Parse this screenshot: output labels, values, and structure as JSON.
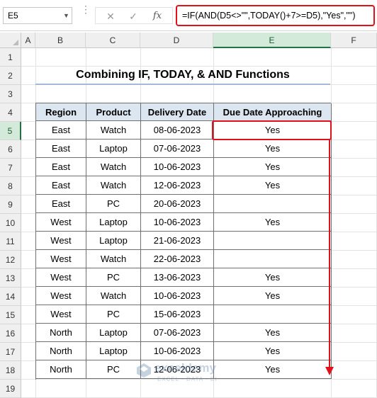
{
  "formula_bar": {
    "name_box": "E5",
    "cancel_icon": "✕",
    "enter_icon": "✓",
    "fx_label": "fx",
    "formula": "=IF(AND(D5<>\"\",TODAY()+7>=D5),\"Yes\",\"\")"
  },
  "columns": [
    "A",
    "B",
    "C",
    "D",
    "E",
    "F"
  ],
  "selected_column": "E",
  "rows": [
    "1",
    "2",
    "3",
    "4",
    "5",
    "6",
    "7",
    "8",
    "9",
    "10",
    "11",
    "12",
    "13",
    "14",
    "15",
    "16",
    "17",
    "18",
    "19"
  ],
  "selected_row": "5",
  "title": "Combining IF, TODAY, & AND Functions",
  "table": {
    "headers": [
      "Region",
      "Product",
      "Delivery Date",
      "Due Date Approaching"
    ],
    "rows": [
      [
        "East",
        "Watch",
        "08-06-2023",
        "Yes"
      ],
      [
        "East",
        "Laptop",
        "07-06-2023",
        "Yes"
      ],
      [
        "East",
        "Watch",
        "10-06-2023",
        "Yes"
      ],
      [
        "East",
        "Watch",
        "12-06-2023",
        "Yes"
      ],
      [
        "East",
        "PC",
        "20-06-2023",
        ""
      ],
      [
        "West",
        "Laptop",
        "10-06-2023",
        "Yes"
      ],
      [
        "West",
        "Laptop",
        "21-06-2023",
        ""
      ],
      [
        "West",
        "Watch",
        "22-06-2023",
        ""
      ],
      [
        "West",
        "PC",
        "13-06-2023",
        "Yes"
      ],
      [
        "West",
        "Watch",
        "10-06-2023",
        "Yes"
      ],
      [
        "West",
        "PC",
        "15-06-2023",
        ""
      ],
      [
        "North",
        "Laptop",
        "07-06-2023",
        "Yes"
      ],
      [
        "North",
        "Laptop",
        "10-06-2023",
        "Yes"
      ],
      [
        "North",
        "PC",
        "12-06-2023",
        "Yes"
      ]
    ]
  },
  "watermark": {
    "name": "exceldemy",
    "tagline": "EXCEL · DATA · BI"
  },
  "colors": {
    "highlight": "#e0111b",
    "header_fill": "#dce6f1",
    "selection_green": "#217346"
  }
}
